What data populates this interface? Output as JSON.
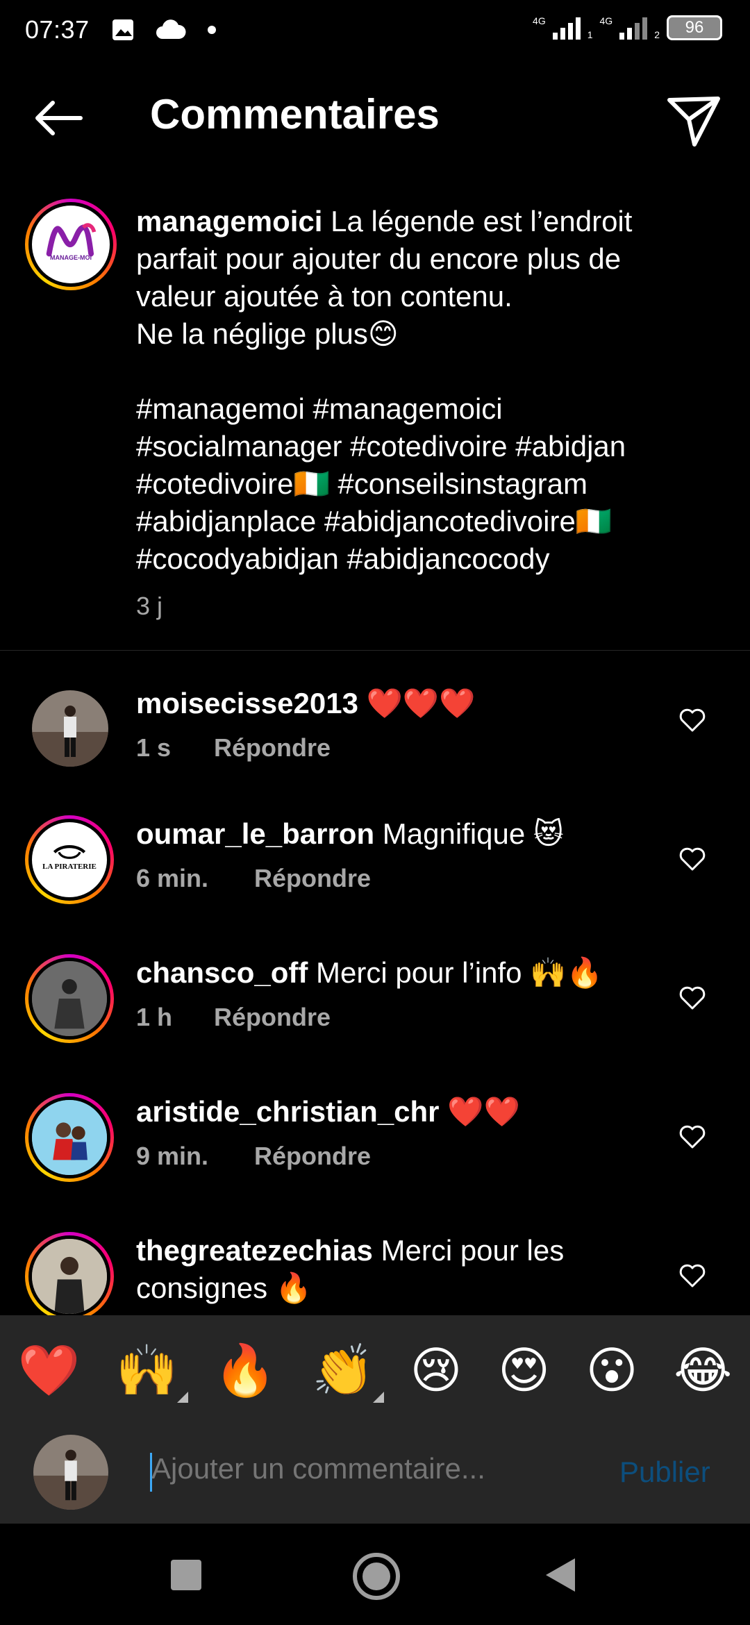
{
  "status_bar": {
    "time": "07:37",
    "network_1": "4G",
    "network_2": "4G",
    "sim_1": "1",
    "sim_2": "2",
    "battery": "96"
  },
  "header": {
    "title": "Commentaires",
    "back_icon": "arrow-left-icon",
    "send_icon": "paper-plane-icon"
  },
  "caption": {
    "username": "managemoici",
    "line1": " La légende est l’endroit",
    "line2": "parfait pour ajouter du encore plus de",
    "line3": "valeur ajoutée à ton contenu.",
    "line4": "Ne la néglige plus😊",
    "tags1": "#managemoi #managemoici",
    "tags2": "#socialmanager #cotedivoire #abidjan",
    "tags3": "#cotedivoire🇨🇮 #conseilsinstagram",
    "tags4": "#abidjanplace #abidjancotedivoire🇨🇮",
    "tags5": "#cocodyabidjan #abidjancocody",
    "time": "3 j",
    "avatar_text": "MANAGE-MOI"
  },
  "comments": [
    {
      "username": "moisecisse2013",
      "text": " ❤️❤️❤️",
      "time": "1 s",
      "reply": "Répondre"
    },
    {
      "username": "oumar_le_barron",
      "text": " Magnifique 😻",
      "time": "6 min.",
      "reply": "Répondre",
      "avatar_text": "LA PIRATERIE"
    },
    {
      "username": "chansco_off",
      "text": " Merci pour l’info 🙌🔥",
      "time": "1 h",
      "reply": "Répondre"
    },
    {
      "username": "aristide_christian_chr",
      "text": " ❤️❤️",
      "time": "9 min.",
      "reply": "Répondre"
    },
    {
      "username": "thegreatezechias",
      "text": " Merci pour les",
      "text2": "consignes 🔥"
    }
  ],
  "emoji_bar": [
    "❤️",
    "🙌",
    "🔥",
    "👏",
    "😢",
    "😍",
    "😮",
    "😂"
  ],
  "composer": {
    "placeholder": "Ajouter un commentaire...",
    "publish": "Publier"
  },
  "colors": {
    "background": "#000000",
    "secondary_text": "#a8a8a8",
    "publish_disabled": "#0c4e7d",
    "panel": "#262626"
  }
}
